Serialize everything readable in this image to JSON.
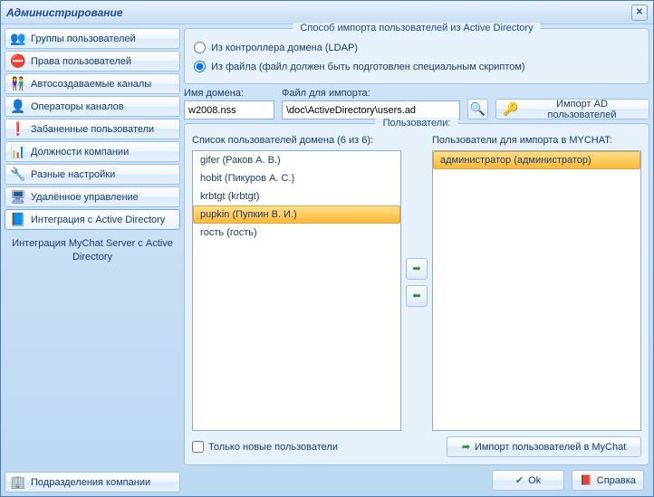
{
  "title": "Администрирование",
  "sidebar": {
    "items": [
      {
        "label": "Группы пользователей",
        "icon": "👥"
      },
      {
        "label": "Права пользователей",
        "icon": "⛔"
      },
      {
        "label": "Автосоздаваемые каналы",
        "icon": "👫"
      },
      {
        "label": "Операторы каналов",
        "icon": "👤"
      },
      {
        "label": "Забаненные пользователи",
        "icon": "❗"
      },
      {
        "label": "Должности компании",
        "icon": "📊"
      },
      {
        "label": "Разные настройки",
        "icon": "🔧"
      },
      {
        "label": "Удалённое управление",
        "icon": "🖥"
      },
      {
        "label": "Интеграция с Active Directory",
        "icon": "📘"
      }
    ],
    "desc": "Интеграция MyChat Server с Active Directory",
    "bottom_label": "Подразделения компании",
    "bottom_icon": "🏢"
  },
  "import_method": {
    "title": "Способ импорта пользователей из Active Directory",
    "opt_ldap": "Из контроллера домена (LDAP)",
    "opt_file": "Из файла (файл должен быть подготовлен специальным скриптом)"
  },
  "fields": {
    "domain_label": "Имя домена:",
    "domain_value": "w2008.nss",
    "file_label": "Файл для импорта:",
    "file_value": "\\doc\\ActiveDirectory\\users.ad",
    "import_btn": "Импорт AD пользователей"
  },
  "users": {
    "box_title": "Пользователи:",
    "left_title": "Список пользователей домена (6 из 6):",
    "right_title": "Пользователи для импорта в MYCHAT:",
    "left_items": [
      {
        "label": "gifer (Раков А. В.)",
        "sel": false
      },
      {
        "label": "hobit (Пикуров А. С.)",
        "sel": false
      },
      {
        "label": "krbtgt (krbtgt)",
        "sel": false
      },
      {
        "label": "pupkin (Пупкин В. И.)",
        "sel": true
      },
      {
        "label": "гость (гость)",
        "sel": false
      }
    ],
    "right_items": [
      {
        "label": "администратор (администратор)",
        "sel": true
      }
    ],
    "only_new": "Только новые пользователи",
    "import_mychat": "Импорт пользователей в MyChat"
  },
  "footer": {
    "ok": "Ok",
    "help": "Справка"
  }
}
